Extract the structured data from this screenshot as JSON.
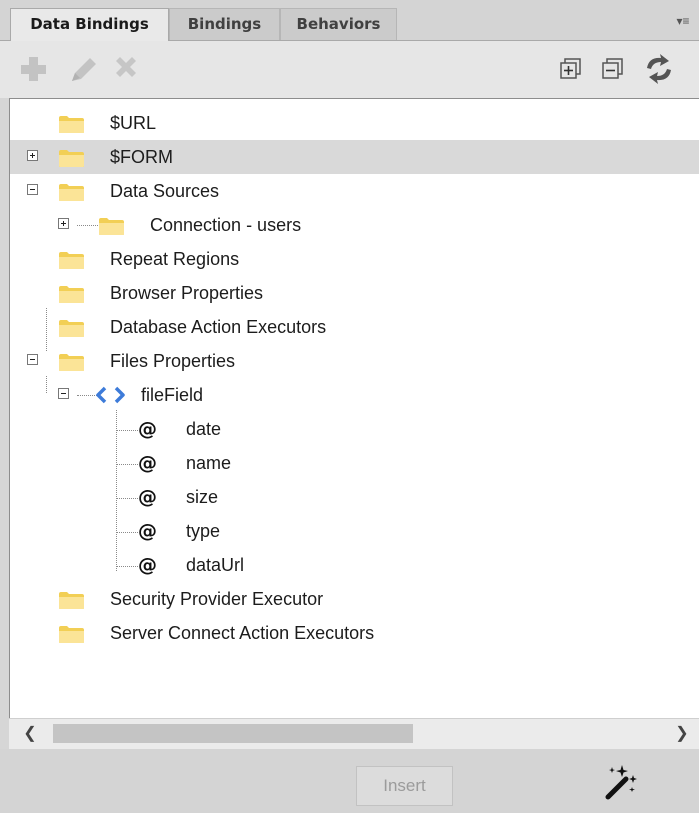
{
  "tabs": [
    {
      "label": "Data Bindings",
      "active": true
    },
    {
      "label": "Bindings",
      "active": false
    },
    {
      "label": "Behaviors",
      "active": false
    }
  ],
  "toolbar": {
    "left_icons": [
      "plus-icon",
      "pencil-icon",
      "delete-icon"
    ],
    "right_icons": [
      "expand-all-icon",
      "collapse-all-icon",
      "refresh-icon"
    ]
  },
  "tree": {
    "url": "$URL",
    "form": "$FORM",
    "data_sources": "Data Sources",
    "connection": "Connection - users",
    "repeat_regions": "Repeat Regions",
    "browser_properties": "Browser Properties",
    "database_action_executors": "Database Action Executors",
    "files_properties": "Files Properties",
    "file_field": "fileField",
    "attributes": [
      "date",
      "name",
      "size",
      "type",
      "dataUrl"
    ],
    "attribute_symbol": "@",
    "security_provider_executor": "Security Provider Executor",
    "server_connect_action_executors": "Server Connect Action Executors"
  },
  "footer": {
    "insert_label": "Insert",
    "wand_icon": "magic-wand-icon"
  },
  "colors": {
    "folder": "#f5d86a",
    "selected_row": "#d9d9d9",
    "file_field_icon": "#3d7bd9"
  }
}
